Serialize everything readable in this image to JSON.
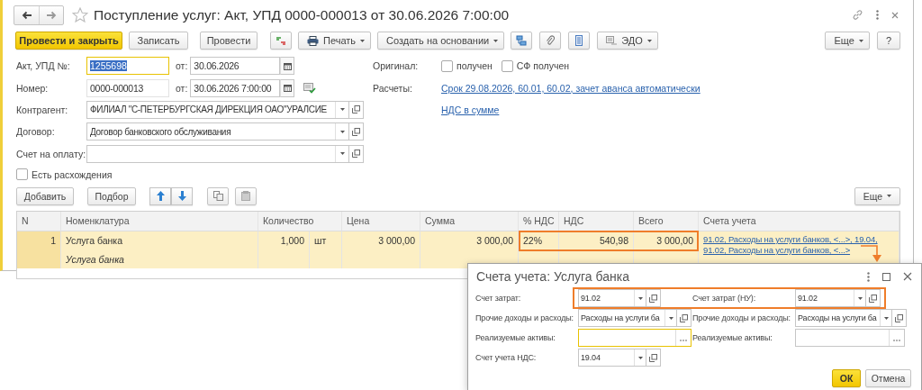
{
  "window": {
    "title": "Поступление услуг: Акт, УПД 0000-000013 от 30.06.2026 7:00:00"
  },
  "toolbar": {
    "buttons": [
      {
        "kind": "primary",
        "label": "Провести и закрыть"
      },
      {
        "kind": "plain",
        "label": "Записать"
      },
      {
        "kind": "plain",
        "label": "Провести"
      },
      {
        "kind": "print",
        "label": "Печать"
      },
      {
        "kind": "menu",
        "label": "Создать на основании"
      },
      {
        "kind": "edo",
        "label": "ЭДО"
      }
    ],
    "right": [
      {
        "kind": "menu",
        "label": "Еще"
      },
      {
        "kind": "plain",
        "label": "?"
      }
    ]
  },
  "form": {
    "number": {
      "label": "Акт, УПД №:",
      "value": "1255698",
      "focused": true
    },
    "number_date": {
      "label": "от:",
      "value": "30.06.2026"
    },
    "doc_number": {
      "label": "Номер:",
      "value": "0000-000013"
    },
    "doc_date": {
      "label": "от:",
      "value": "30.06.2026  7:00:00"
    },
    "counterparty": {
      "label": "Контрагент:",
      "value": "ФИЛИАЛ \"С-ПЕТЕРБУРГСКАЯ ДИРЕКЦИЯ ОАО\"УРАЛСИЕ"
    },
    "contract": {
      "label": "Договор:",
      "value": "Договор банковского обслуживания"
    },
    "invoice": {
      "label": "Счет на оплату:"
    },
    "discrepancies": {
      "label": "Есть расхождения",
      "checked": false
    },
    "original": {
      "label": "Оригинал:",
      "checks": [
        {
          "label": "получен",
          "checked": false
        },
        {
          "label": "СФ получен",
          "checked": false
        }
      ]
    },
    "settlements": {
      "label": "Расчеты:",
      "link": "Срок 29.08.2026, 60.01, 60.02, зачет аванса автоматически"
    },
    "vat_link": "НДС в сумме"
  },
  "table": {
    "buttons": [
      {
        "label": "Добавить"
      },
      {
        "label": "Подбор"
      }
    ],
    "more": "Еще",
    "columns": [
      "N",
      "Номенклатура",
      "Количество",
      "Цена",
      "Сумма",
      "% НДС",
      "НДС",
      "Всего",
      "Счета учета"
    ],
    "rows": [
      {
        "selected": true,
        "vat_highlighted": true,
        "n": "1",
        "name": "Услуга банка",
        "content": "Услуга банка",
        "quantity": "1,000",
        "unit": "шт",
        "price": "3 000,00",
        "sum": "3 000,00",
        "vat_rate": "22%",
        "vat": "540,98",
        "total": "3 000,00",
        "accounts": [
          "91.02, Расходы на услуги банков, <...>, 19.04,",
          "91.02, Расходы на услуги банков, <...>"
        ]
      }
    ]
  },
  "callout_arrow": true,
  "dialog": {
    "title": "Счета учета: Услуга банка",
    "rows": [
      {
        "highlighted": true,
        "fields": [
          {
            "kind": "combo",
            "label": "Счет затрат:",
            "value": "91.02"
          },
          {
            "kind": "combo",
            "label": "Счет затрат (НУ):",
            "value": "91.02"
          }
        ]
      },
      {
        "fields": [
          {
            "kind": "combo",
            "label": "Прочие доходы и расходы:",
            "value": "Расходы на услуги ба"
          },
          {
            "kind": "combo",
            "label": "Прочие доходы и расходы:",
            "value": "Расходы на услуги ба"
          }
        ]
      },
      {
        "fields": [
          {
            "kind": "choice",
            "label": "Реализуемые активы:",
            "focused": true
          },
          {
            "kind": "choice",
            "label": "Реализуемые активы:",
            "focused": false
          }
        ]
      },
      {
        "fields": [
          {
            "kind": "combo",
            "label": "Счет учета НДС:",
            "value": "19.04"
          }
        ]
      }
    ],
    "buttons": [
      {
        "kind": "primary",
        "label": "ОК"
      },
      {
        "kind": "plain",
        "label": "Отмена"
      }
    ]
  }
}
